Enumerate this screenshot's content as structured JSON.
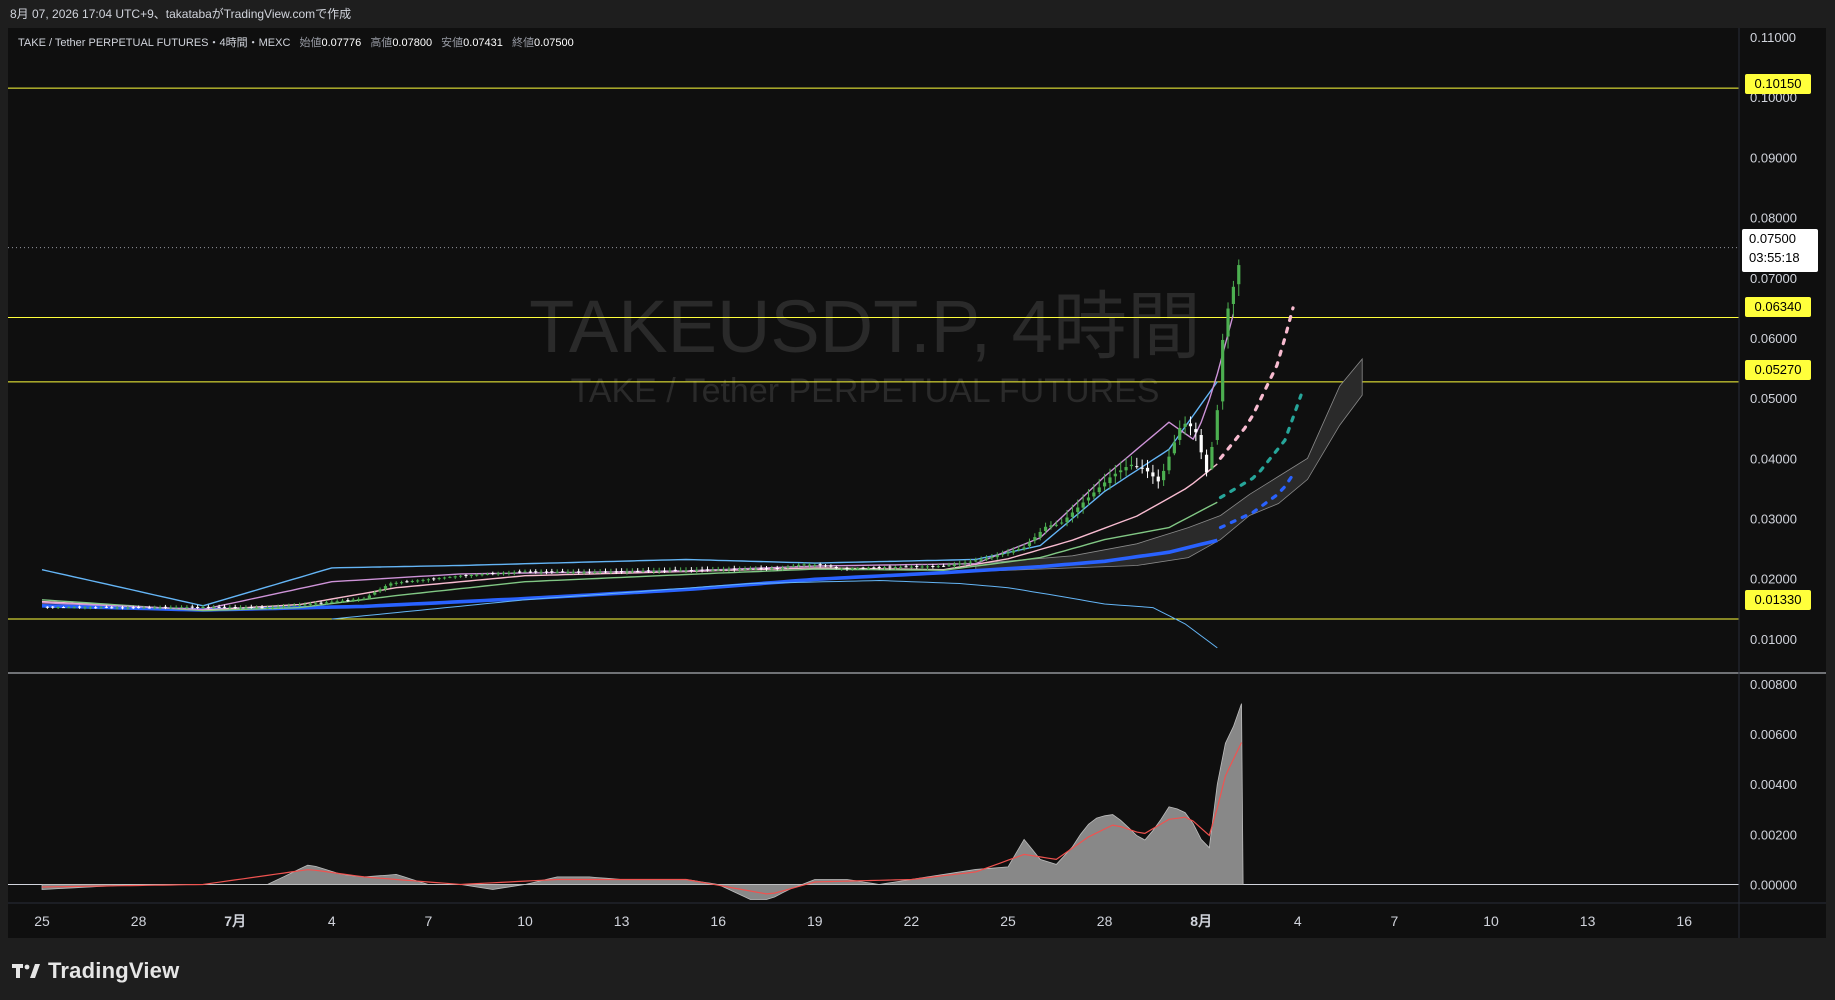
{
  "header": {
    "caption": "8月 07, 2026 17:04 UTC+9、takatabaがTradingView.comで作成"
  },
  "legend": {
    "symbol": "TAKE / Tether PERPETUAL FUTURES・4時間・MEXC",
    "open_label": "始値",
    "open": "0.07776",
    "high_label": "高値",
    "high": "0.07800",
    "low_label": "安値",
    "low": "0.07431",
    "close_label": "終値",
    "close": "0.07500"
  },
  "watermark": {
    "main": "TAKEUSDT.P, 4時間",
    "sub": "TAKE / Tether PERPETUAL FUTURES"
  },
  "price_box": {
    "price": "0.07500",
    "countdown": "03:55:18"
  },
  "levels": [
    "0.10150",
    "0.06340",
    "0.05270",
    "0.01330"
  ],
  "footer": {
    "brand": "TradingView"
  },
  "colors": {
    "background": "#0f0f0f",
    "level_line": "#ffff3b",
    "level_tag": "#ffff3b",
    "candle_up": "#4caf50",
    "candle_down": "#ffffff",
    "ma_blue_thick": "#2962ff",
    "ma_pink": "#f8bbd0",
    "ma_green": "#81c784",
    "ma_light_blue": "#64b5f6",
    "ma_purple": "#ce93d8",
    "dots_pink": "#f8bbd0",
    "dots_teal": "#26a69a",
    "dots_blue": "#2962ff",
    "osc_fill": "#9e9e9e",
    "osc_signal": "#ef5350"
  },
  "chart_data": [
    {
      "type": "candlestick",
      "title": "TAKEUSDT.P, 4時間",
      "x_tick_labels": [
        "25",
        "28",
        "7月",
        "4",
        "7",
        "10",
        "13",
        "16",
        "19",
        "22",
        "25",
        "28",
        "8月",
        "4",
        "7",
        "10",
        "13",
        "16"
      ],
      "y_tick_labels": [
        "0.11000",
        "0.10000",
        "0.09000",
        "0.08000",
        "0.07000",
        "0.06000",
        "0.05000",
        "0.04000",
        "0.03000",
        "0.02000",
        "0.01000"
      ],
      "ylim": [
        0.0045,
        0.1115
      ],
      "horizontal_levels": [
        0.1015,
        0.0634,
        0.0527,
        0.0133
      ],
      "last_price": 0.075,
      "close_path": {
        "t": [
          0,
          3,
          5,
          7,
          8.3,
          10,
          10.8,
          13,
          15,
          17,
          19,
          21,
          23,
          23.6,
          24.3,
          24.8,
          26,
          28,
          28.8,
          29.5,
          30.5,
          31.2,
          31.6,
          32.2,
          33.2,
          33.8,
          34.3,
          34.7,
          35.4,
          35.8,
          36.2,
          36.5,
          36.7,
          37.3
        ],
        "close": [
          0.0153,
          0.0152,
          0.0153,
          0.0152,
          0.0158,
          0.0167,
          0.0192,
          0.0205,
          0.0212,
          0.0211,
          0.0213,
          0.0215,
          0.0218,
          0.0224,
          0.0222,
          0.0217,
          0.0219,
          0.0221,
          0.0228,
          0.0236,
          0.0252,
          0.0288,
          0.029,
          0.032,
          0.037,
          0.039,
          0.038,
          0.036,
          0.046,
          0.045,
          0.037,
          0.048,
          0.062,
          0.075
        ]
      },
      "moving_averages": [
        {
          "color": "#2962ff",
          "width": "thick",
          "t": [
            0,
            5,
            10,
            15,
            20,
            24,
            28,
            31,
            33,
            35,
            36.6
          ],
          "v": [
            0.0155,
            0.0148,
            0.0154,
            0.0167,
            0.0182,
            0.0199,
            0.021,
            0.022,
            0.0229,
            0.0244,
            0.0265
          ]
        },
        {
          "color": "#f8bbd0",
          "t": [
            0,
            5,
            8,
            11,
            15,
            20,
            24,
            28,
            30,
            32,
            34,
            35.6,
            36.6
          ],
          "v": [
            0.0162,
            0.0148,
            0.0157,
            0.0185,
            0.0205,
            0.0212,
            0.0218,
            0.0215,
            0.0233,
            0.0264,
            0.0304,
            0.0352,
            0.0395
          ]
        },
        {
          "color": "#81c784",
          "t": [
            0,
            5,
            8,
            11,
            15,
            20,
            24,
            28,
            31,
            33,
            35,
            36.6
          ],
          "v": [
            0.0165,
            0.0147,
            0.0152,
            0.0172,
            0.0195,
            0.0207,
            0.0216,
            0.0214,
            0.0235,
            0.0265,
            0.0285,
            0.033
          ]
        },
        {
          "color": "#64b5f6",
          "t": [
            0,
            5,
            9,
            13,
            20,
            24,
            29,
            31,
            33,
            35,
            36.6
          ],
          "v": [
            0.0215,
            0.0155,
            0.0218,
            0.0222,
            0.0232,
            0.0226,
            0.0232,
            0.0255,
            0.0345,
            0.0415,
            0.0535
          ]
        },
        {
          "color": "#ce93d8",
          "t": [
            0,
            5,
            9,
            13,
            20,
            24,
            29,
            31,
            33,
            35,
            35.8,
            36.4,
            37.2
          ],
          "v": [
            0.016,
            0.0149,
            0.0195,
            0.0208,
            0.0213,
            0.0221,
            0.0225,
            0.0268,
            0.037,
            0.046,
            0.043,
            0.052,
            0.068
          ]
        },
        {
          "color": "#64b5f6",
          "width": "thin",
          "t": [
            9,
            15,
            22,
            26,
            28.5,
            30,
            31.5,
            33,
            34.5,
            35.5,
            36.5
          ],
          "v": [
            0.0133,
            0.0165,
            0.0192,
            0.0197,
            0.0192,
            0.0185,
            0.0172,
            0.0158,
            0.0152,
            0.0125,
            0.0085
          ]
        }
      ],
      "projections": [
        {
          "color": "#f8bbd0",
          "t": [
            36.6,
            37.5,
            38.4,
            39.0
          ],
          "v": [
            0.04,
            0.046,
            0.056,
            0.068
          ]
        },
        {
          "color": "#26a69a",
          "t": [
            36.6,
            37.7,
            38.6,
            39.1
          ],
          "v": [
            0.0335,
            0.037,
            0.043,
            0.0505
          ]
        },
        {
          "color": "#2962ff",
          "t": [
            36.6,
            37.6,
            38.5,
            39.0
          ],
          "v": [
            0.0285,
            0.031,
            0.0345,
            0.0385
          ]
        }
      ],
      "cloud": {
        "color": "#2a2a2a",
        "t": [
          29,
          32,
          34,
          35.6,
          36.6,
          37.5,
          38.4,
          39.3,
          40.3,
          41.0
        ],
        "upper": [
          0.0225,
          0.0238,
          0.0258,
          0.0285,
          0.0305,
          0.034,
          0.037,
          0.04,
          0.052,
          0.0565
        ],
        "lower": [
          0.0212,
          0.0218,
          0.0222,
          0.0235,
          0.0265,
          0.0305,
          0.0325,
          0.0365,
          0.0455,
          0.0505
        ]
      }
    },
    {
      "type": "area",
      "title": "",
      "y_tick_labels": [
        "0.00800",
        "0.00600",
        "0.00400",
        "0.00200",
        "0.00000"
      ],
      "ylim": [
        -0.0007,
        0.0084
      ],
      "series": [
        {
          "style": "area",
          "color": "#9e9e9e",
          "t": [
            0,
            3,
            5,
            7,
            8.3,
            9.3,
            10,
            11,
            12,
            13,
            14,
            15,
            16,
            17,
            18,
            19,
            20,
            21,
            22,
            22.6,
            23.2,
            24,
            25,
            26,
            27,
            28,
            29,
            30,
            30.5,
            31,
            31.5,
            32,
            32.4,
            32.8,
            33.3,
            33.8,
            34.2,
            34.6,
            35.0,
            35.3,
            35.6,
            36.0,
            36.3,
            36.5,
            36.7,
            37.0,
            37.3
          ],
          "v": [
            -0.0002,
            0.0,
            0.0,
            0.0,
            0.0008,
            0.0004,
            0.0003,
            0.0004,
            0.0,
            0.0,
            -0.0002,
            0.0,
            0.0003,
            0.0003,
            0.0002,
            0.0002,
            0.0002,
            0.0,
            -0.0006,
            -0.0006,
            -0.0002,
            0.0002,
            0.0002,
            0.0,
            0.0002,
            0.0004,
            0.0006,
            0.0007,
            0.0018,
            0.001,
            0.0008,
            0.0015,
            0.0023,
            0.0027,
            0.0028,
            0.0022,
            0.0017,
            0.0023,
            0.0031,
            0.003,
            0.0028,
            0.0018,
            0.0014,
            0.004,
            0.0055,
            0.0063,
            0.0074
          ]
        },
        {
          "style": "line",
          "color": "#ef5350",
          "t": [
            0,
            5,
            8.3,
            10,
            13,
            16,
            20,
            22.6,
            24,
            27,
            29,
            30.5,
            31.5,
            32.5,
            33.3,
            34.2,
            35.0,
            35.6,
            36.3,
            36.7,
            37.3
          ],
          "v": [
            -0.0001,
            0.0,
            0.0006,
            0.0003,
            0.0,
            0.0002,
            0.0002,
            -0.0004,
            0.0001,
            0.0002,
            0.0005,
            0.0012,
            0.001,
            0.0019,
            0.0024,
            0.002,
            0.0026,
            0.0027,
            0.0019,
            0.0042,
            0.0058
          ]
        }
      ]
    }
  ]
}
